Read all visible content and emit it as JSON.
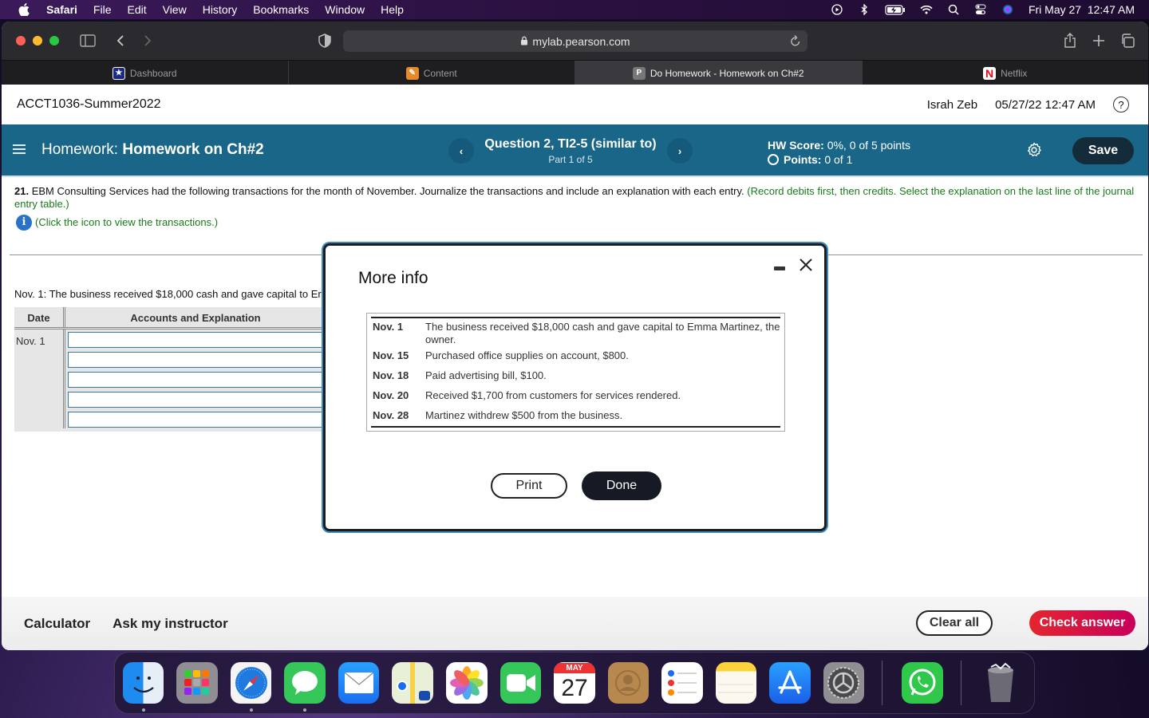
{
  "menubar": {
    "app": "Safari",
    "items": [
      "File",
      "Edit",
      "View",
      "History",
      "Bookmarks",
      "Window",
      "Help"
    ],
    "clock": "Fri May 27  12:47 AM",
    "status_icons": [
      "play-circle-icon",
      "bluetooth-icon",
      "battery-charging-icon",
      "wifi-icon",
      "spotlight-search-icon",
      "control-center-icon",
      "siri-icon"
    ]
  },
  "browser": {
    "url": "mylab.pearson.com",
    "tabs": [
      {
        "label": "Dashboard",
        "icon": "dashboard-star-icon",
        "active": false
      },
      {
        "label": "Content",
        "icon": "content-pencil-icon",
        "active": false
      },
      {
        "label": "Do Homework - Homework on Ch#2",
        "icon": "pearson-p-icon",
        "favicon_text": "P",
        "active": true
      },
      {
        "label": "Netflix",
        "icon": "netflix-icon",
        "favicon_text": "N",
        "active": false
      }
    ]
  },
  "course": {
    "title": "ACCT1036-Summer2022",
    "user": "Israh Zeb",
    "datetime": "05/27/22 12:47 AM",
    "help": "?"
  },
  "homework_bar": {
    "prefix": "Homework:",
    "name": "Homework on Ch#2",
    "question_title": "Question 2, TI2-5 (similar to)",
    "part": "Part 1 of 5",
    "prev": "‹",
    "next": "›",
    "hw_score_label": "HW Score:",
    "hw_score_value": "0%, 0 of 5 points",
    "points_label": "Points:",
    "points_value": "0 of 1",
    "save_label": "Save",
    "accent_color": "#1a6688"
  },
  "question": {
    "number": "21.",
    "text": "EBM Consulting Services had the following transactions for the month of November. Journalize the transactions and include an explanation with each entry.",
    "instruction": "(Record debits first, then credits. Select the explanation on the last line of the journal entry table.)",
    "info_hint": "(Click the icon to view the transactions.)"
  },
  "journal": {
    "prompt": "Nov. 1: The business received $18,000 cash and gave capital to Er",
    "columns": [
      "Date",
      "Accounts and Explanation"
    ],
    "date": "Nov. 1",
    "inputs": [
      "",
      "",
      "",
      "",
      ""
    ]
  },
  "modal": {
    "title": "More info",
    "transactions": [
      {
        "date": "Nov. 1",
        "text": "The business received $18,000 cash and gave capital to Emma Martinez, the owner."
      },
      {
        "date": "Nov. 15",
        "text": "Purchased office supplies on account, $800."
      },
      {
        "date": "Nov. 18",
        "text": "Paid advertising bill, $100."
      },
      {
        "date": "Nov. 20",
        "text": "Received $1,700 from customers for services rendered."
      },
      {
        "date": "Nov. 28",
        "text": "Martinez withdrew $500 from the business."
      }
    ],
    "print_label": "Print",
    "done_label": "Done"
  },
  "footer": {
    "calculator": "Calculator",
    "ask": "Ask my instructor",
    "clear_all": "Clear all",
    "check_answer": "Check answer"
  },
  "dock": {
    "apps": [
      "Finder",
      "Launchpad",
      "Safari",
      "Messages",
      "Mail",
      "Maps",
      "Photos",
      "FaceTime",
      "Calendar",
      "Contacts",
      "Reminders",
      "Notes",
      "App Store",
      "System Preferences",
      "WhatsApp",
      "Trash"
    ],
    "calendar_month": "MAY",
    "calendar_day": "27"
  }
}
